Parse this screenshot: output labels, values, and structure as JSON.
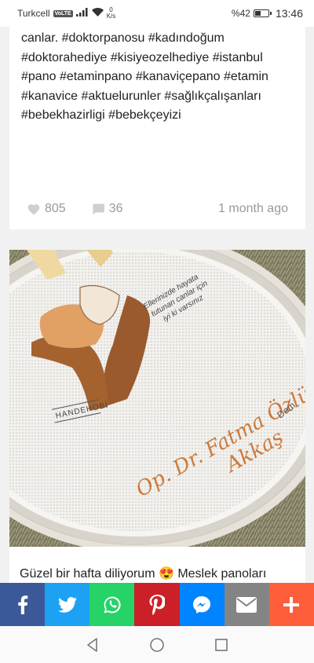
{
  "status_bar": {
    "carrier": "Turkcell",
    "network_badge": "VoLTE",
    "data_rate_value": "0",
    "data_rate_unit": "K/s",
    "battery_percent": "%42",
    "battery_level": 0.42,
    "time": "13:46"
  },
  "post1": {
    "text": "canlar. #doktorpanosu #kadındoğum #doktorahediye #kisiyeozelhediye #istanbul #pano #etaminpano #kanaviçepano #etamin #kanavice #aktuelurunler #sağlıkçalışanları #bebekhazirligi #bebekçeyizi",
    "likes": "805",
    "comments": "36",
    "time_ago": "1 month ago"
  },
  "post2": {
    "embroidery_quote_line1": "Ellerinizde hayata",
    "embroidery_quote_line2": "tutunan canlar için",
    "embroidery_quote_line3": "iyi ki varsınız",
    "embroidery_name_line1": "Op. Dr. Fatma Özlü",
    "embroidery_name_line2": "Akkaş",
    "embroidery_partial": "Dem",
    "embroidery_brand": "HANDEHOBİ",
    "caption": "Güzel bir hafta diliyorum 😍 Meslek panoları"
  },
  "share": [
    {
      "name": "facebook",
      "icon": "facebook-icon",
      "color": "#3b5998"
    },
    {
      "name": "twitter",
      "icon": "twitter-icon",
      "color": "#1da1f2"
    },
    {
      "name": "whatsapp",
      "icon": "whatsapp-icon",
      "color": "#25d366"
    },
    {
      "name": "pinterest",
      "icon": "pinterest-icon",
      "color": "#cb2027"
    },
    {
      "name": "messenger",
      "icon": "messenger-icon",
      "color": "#0084ff"
    },
    {
      "name": "email",
      "icon": "email-icon",
      "color": "#848484"
    },
    {
      "name": "more",
      "icon": "plus-icon",
      "color": "#ff5e3a"
    }
  ],
  "nav": [
    "back-icon",
    "home-icon",
    "recents-icon"
  ]
}
